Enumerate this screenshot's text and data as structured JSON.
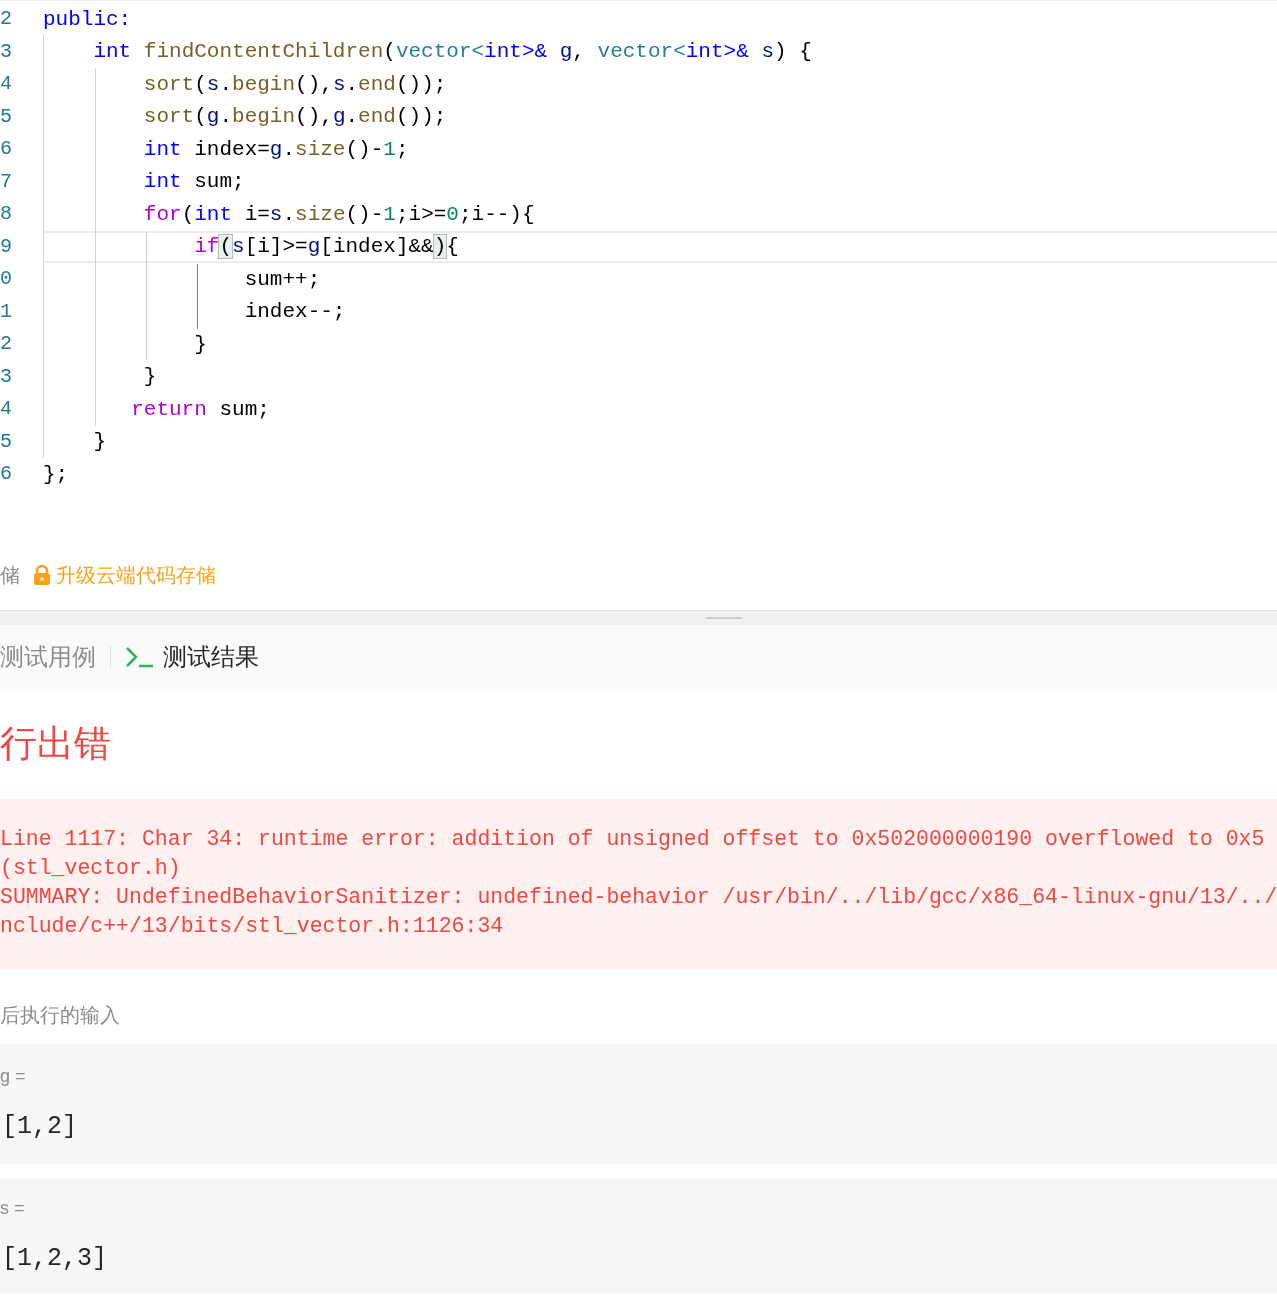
{
  "editor": {
    "lines": [
      {
        "number": "2",
        "current": false,
        "tokens": [
          {
            "text": "public:",
            "kind": "keyword"
          }
        ]
      },
      {
        "number": "3",
        "current": false,
        "tokens": [
          {
            "text": "    int",
            "kind": "keyword"
          },
          {
            "text": " findContentChildren",
            "kind": "function"
          },
          {
            "text": "(",
            "kind": "plain"
          },
          {
            "text": "vector<",
            "kind": "type"
          },
          {
            "text": "int>&",
            "kind": "keyword"
          },
          {
            "text": " g",
            "kind": "variable"
          },
          {
            "text": ", ",
            "kind": "plain"
          },
          {
            "text": "vector<",
            "kind": "type"
          },
          {
            "text": "int>&",
            "kind": "keyword"
          },
          {
            "text": " s",
            "kind": "variable"
          },
          {
            "text": ") {",
            "kind": "plain"
          }
        ]
      },
      {
        "number": "4",
        "current": false,
        "tokens": [
          {
            "text": "        sort",
            "kind": "function"
          },
          {
            "text": "(",
            "kind": "plain"
          },
          {
            "text": "s",
            "kind": "variable"
          },
          {
            "text": ".",
            "kind": "plain"
          },
          {
            "text": "begin",
            "kind": "function"
          },
          {
            "text": "(),",
            "kind": "plain"
          },
          {
            "text": "s",
            "kind": "variable"
          },
          {
            "text": ".",
            "kind": "plain"
          },
          {
            "text": "end",
            "kind": "function"
          },
          {
            "text": "());",
            "kind": "plain"
          }
        ]
      },
      {
        "number": "5",
        "current": false,
        "tokens": [
          {
            "text": "        sort",
            "kind": "function"
          },
          {
            "text": "(",
            "kind": "plain"
          },
          {
            "text": "g",
            "kind": "variable"
          },
          {
            "text": ".",
            "kind": "plain"
          },
          {
            "text": "begin",
            "kind": "function"
          },
          {
            "text": "(),",
            "kind": "plain"
          },
          {
            "text": "g",
            "kind": "variable"
          },
          {
            "text": ".",
            "kind": "plain"
          },
          {
            "text": "end",
            "kind": "function"
          },
          {
            "text": "());",
            "kind": "plain"
          }
        ]
      },
      {
        "number": "6",
        "current": false,
        "tokens": [
          {
            "text": "        int",
            "kind": "keyword"
          },
          {
            "text": " index=",
            "kind": "plain"
          },
          {
            "text": "g",
            "kind": "variable"
          },
          {
            "text": ".",
            "kind": "plain"
          },
          {
            "text": "size",
            "kind": "function"
          },
          {
            "text": "()-",
            "kind": "plain"
          },
          {
            "text": "1",
            "kind": "number"
          },
          {
            "text": ";",
            "kind": "plain"
          }
        ]
      },
      {
        "number": "7",
        "current": false,
        "tokens": [
          {
            "text": "        int",
            "kind": "keyword"
          },
          {
            "text": " sum;",
            "kind": "plain"
          }
        ]
      },
      {
        "number": "8",
        "current": false,
        "tokens": [
          {
            "text": "        for",
            "kind": "control"
          },
          {
            "text": "(",
            "kind": "plain"
          },
          {
            "text": "int",
            "kind": "keyword"
          },
          {
            "text": " i=",
            "kind": "plain"
          },
          {
            "text": "s",
            "kind": "variable"
          },
          {
            "text": ".",
            "kind": "plain"
          },
          {
            "text": "size",
            "kind": "function"
          },
          {
            "text": "()-",
            "kind": "plain"
          },
          {
            "text": "1",
            "kind": "number"
          },
          {
            "text": ";i>=",
            "kind": "plain"
          },
          {
            "text": "0",
            "kind": "number"
          },
          {
            "text": ";i--){",
            "kind": "plain"
          }
        ]
      },
      {
        "number": "9",
        "current": true,
        "tokens": [
          {
            "text": "            if",
            "kind": "control"
          },
          {
            "text": "(",
            "kind": "bracket"
          },
          {
            "text": "s",
            "kind": "variable"
          },
          {
            "text": "[i]>=",
            "kind": "plain"
          },
          {
            "text": "g",
            "kind": "variable"
          },
          {
            "text": "[index]&&",
            "kind": "plain"
          },
          {
            "text": ")",
            "kind": "bracket"
          },
          {
            "text": "{",
            "kind": "plain"
          }
        ]
      },
      {
        "number": "0",
        "current": false,
        "tokens": [
          {
            "text": "                sum++;",
            "kind": "plain"
          }
        ]
      },
      {
        "number": "1",
        "current": false,
        "tokens": [
          {
            "text": "                index--;",
            "kind": "plain"
          }
        ]
      },
      {
        "number": "2",
        "current": false,
        "tokens": [
          {
            "text": "            }",
            "kind": "plain"
          }
        ]
      },
      {
        "number": "3",
        "current": false,
        "tokens": [
          {
            "text": "        }",
            "kind": "plain"
          }
        ]
      },
      {
        "number": "4",
        "current": false,
        "tokens": [
          {
            "text": "       return",
            "kind": "control"
          },
          {
            "text": " sum;",
            "kind": "plain"
          }
        ]
      },
      {
        "number": "5",
        "current": false,
        "tokens": [
          {
            "text": "    }",
            "kind": "plain"
          }
        ]
      },
      {
        "number": "6",
        "current": false,
        "tokens": [
          {
            "text": "};",
            "kind": "plain"
          }
        ]
      }
    ]
  },
  "storage_bar": {
    "local_label": "储",
    "upgrade_link": "升级云端代码存储"
  },
  "tabs": [
    {
      "label": "测试用例",
      "selected": false
    },
    {
      "label": "测试结果",
      "selected": true
    }
  ],
  "result": {
    "status": "行出错",
    "error_lines": [
      "Line 1117: Char 34: runtime error: addition of unsigned offset to 0x502000000190 overflowed to 0x5",
      "(stl_vector.h)",
      "SUMMARY: UndefinedBehaviorSanitizer: undefined-behavior /usr/bin/../lib/gcc/x86_64-linux-gnu/13/../",
      "nclude/c++/13/bits/stl_vector.h:1126:34"
    ],
    "input_label": "后执行的输入",
    "inputs": [
      {
        "name": "g =",
        "value": "[1,2]"
      },
      {
        "name": "s =",
        "value": "[1,2,3]"
      }
    ]
  }
}
